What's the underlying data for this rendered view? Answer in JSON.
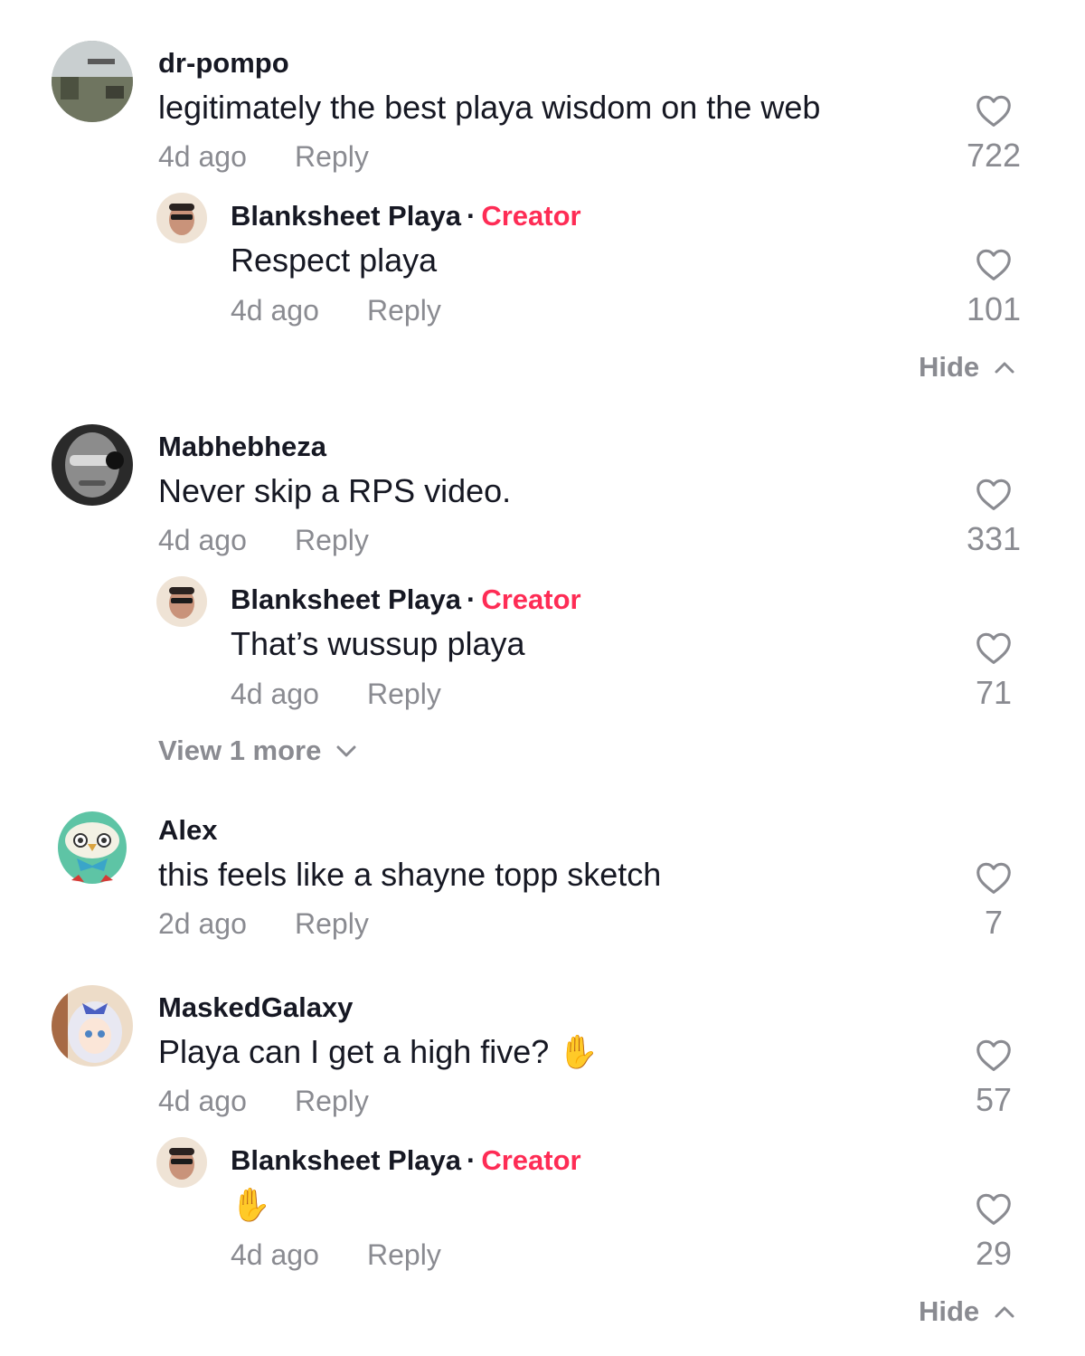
{
  "comments": [
    {
      "username": "dr-pompo",
      "text": "legitimately the best playa wisdom on the web",
      "time": "4d ago",
      "reply_label": "Reply",
      "likes": "722",
      "reply": {
        "username": "Blanksheet Playa",
        "separator": "·",
        "badge": "Creator",
        "text": "Respect playa",
        "time": "4d ago",
        "reply_label": "Reply",
        "likes": "101"
      },
      "toggle_label": "Hide"
    },
    {
      "username": "Mabhebheza",
      "text": "Never skip a RPS video.",
      "time": "4d ago",
      "reply_label": "Reply",
      "likes": "331",
      "reply": {
        "username": "Blanksheet Playa",
        "separator": "·",
        "badge": "Creator",
        "text": "That’s wussup playa",
        "time": "4d ago",
        "reply_label": "Reply",
        "likes": "71"
      },
      "toggle_label": "View 1 more"
    },
    {
      "username": "Alex",
      "text": "this feels like a shayne topp sketch",
      "time": "2d ago",
      "reply_label": "Reply",
      "likes": "7"
    },
    {
      "username": "MaskedGalaxy",
      "text": "Playa can I get a high five?",
      "emoji": "✋",
      "time": "4d ago",
      "reply_label": "Reply",
      "likes": "57",
      "reply": {
        "username": "Blanksheet Playa",
        "separator": "·",
        "badge": "Creator",
        "text": "✋",
        "time": "4d ago",
        "reply_label": "Reply",
        "likes": "29"
      },
      "toggle_label": "Hide"
    }
  ],
  "icons": {
    "like": "heart-outline-icon",
    "collapse": "chevron-up-icon",
    "expand": "chevron-down-icon"
  },
  "colors": {
    "creator_badge": "#fe2c55",
    "secondary_text": "#8a8b91",
    "primary_text": "#161823"
  }
}
